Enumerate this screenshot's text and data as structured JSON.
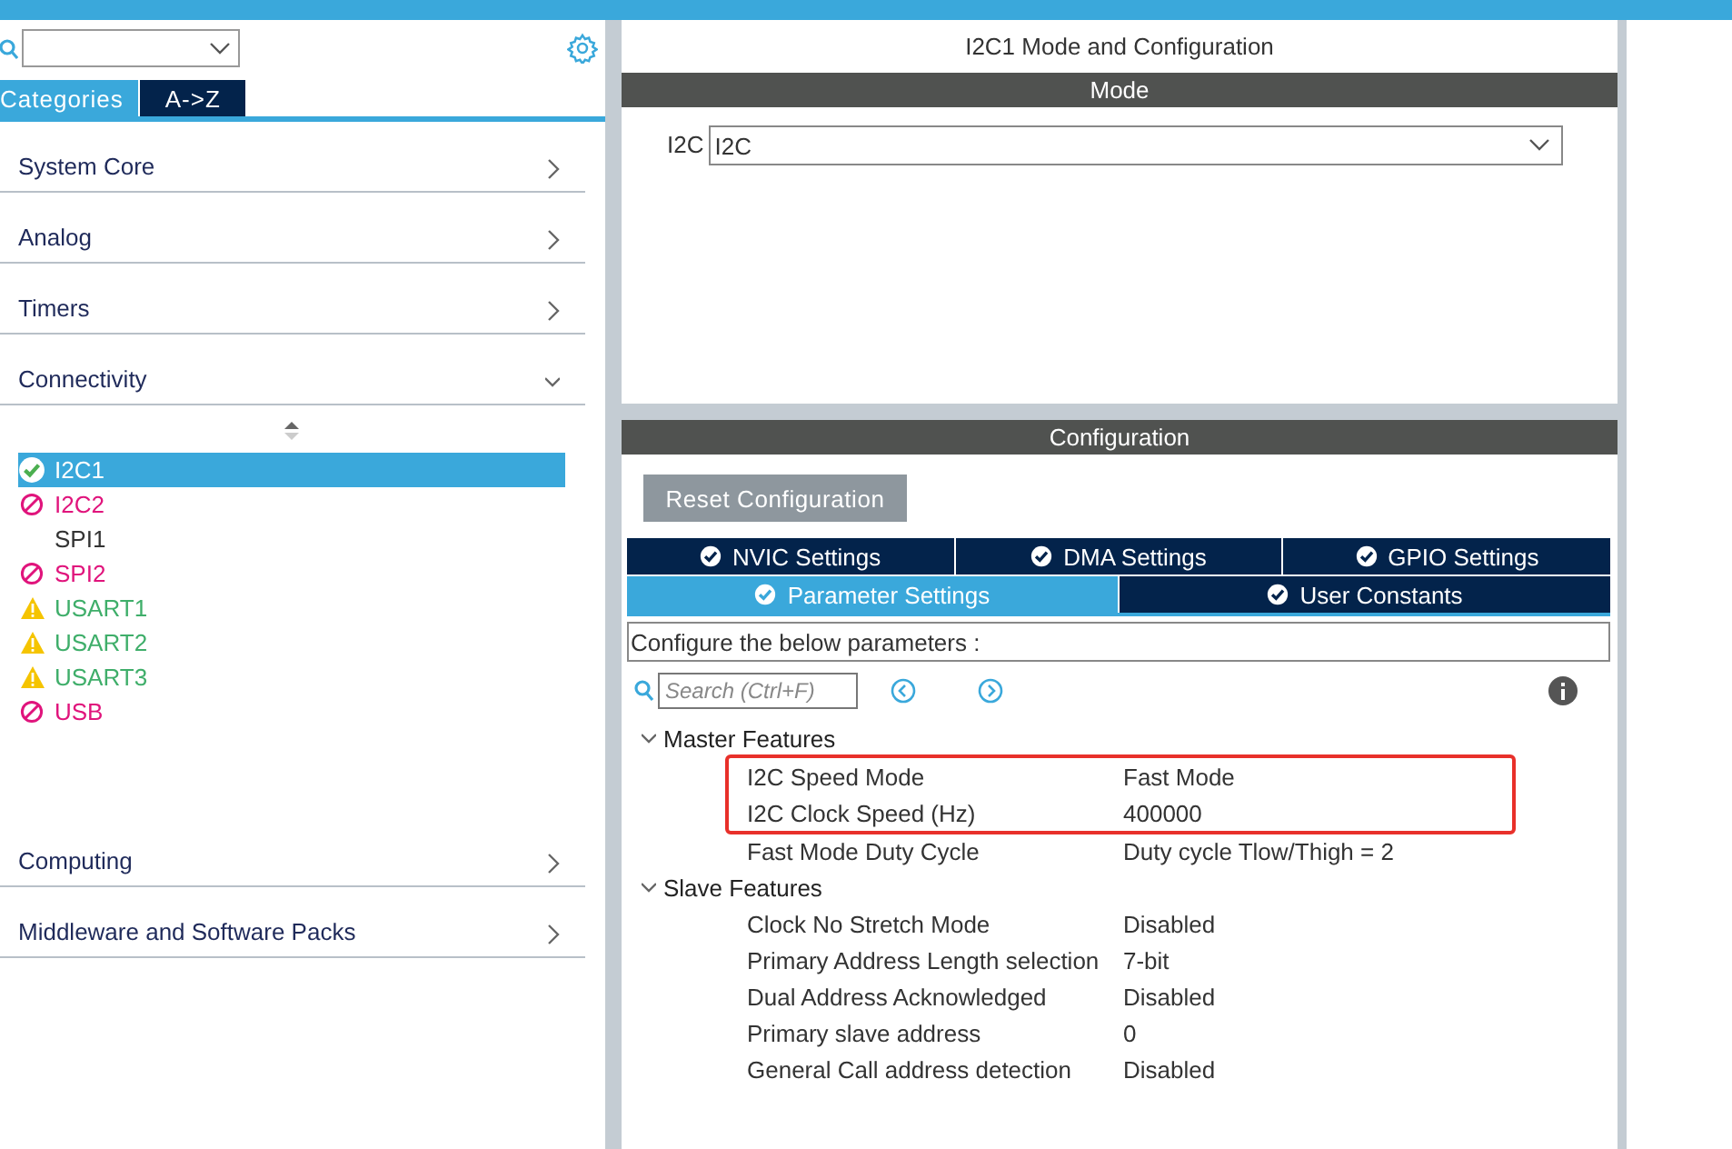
{
  "sidebar": {
    "view_tabs": [
      {
        "label": "Categories",
        "selected": true
      },
      {
        "label": "A->Z",
        "selected": false
      }
    ],
    "categories": [
      {
        "label": "System Core",
        "expanded": false
      },
      {
        "label": "Analog",
        "expanded": false
      },
      {
        "label": "Timers",
        "expanded": false
      },
      {
        "label": "Connectivity",
        "expanded": true,
        "children": [
          {
            "label": "I2C1",
            "kind": "ok",
            "selected": true
          },
          {
            "label": "I2C2",
            "kind": "blocked",
            "selected": false
          },
          {
            "label": "SPI1",
            "kind": "none",
            "selected": false
          },
          {
            "label": "SPI2",
            "kind": "blocked",
            "selected": false
          },
          {
            "label": "USART1",
            "kind": "warning",
            "selected": false
          },
          {
            "label": "USART2",
            "kind": "warning",
            "selected": false
          },
          {
            "label": "USART3",
            "kind": "warning",
            "selected": false
          },
          {
            "label": "USB",
            "kind": "blocked",
            "selected": false
          }
        ]
      },
      {
        "label": "Computing",
        "expanded": false
      },
      {
        "label": "Middleware and Software Packs",
        "expanded": false
      }
    ]
  },
  "main": {
    "title": "I2C1 Mode and Configuration",
    "mode": {
      "header": "Mode",
      "field_label": "I2C",
      "field_value": "I2C"
    },
    "configuration": {
      "header": "Configuration",
      "reset_button": "Reset Configuration",
      "tab_rows": [
        [
          {
            "label": "NVIC Settings",
            "selected": false
          },
          {
            "label": "DMA Settings",
            "selected": false
          },
          {
            "label": "GPIO Settings",
            "selected": false
          }
        ],
        [
          {
            "label": "Parameter Settings",
            "selected": true
          },
          {
            "label": "User Constants",
            "selected": false
          }
        ]
      ],
      "hint": "Configure the below parameters :",
      "search_placeholder": "Search (Ctrl+F)",
      "groups": [
        {
          "name": "Master Features",
          "expanded": true,
          "params": [
            {
              "name": "I2C Speed Mode",
              "value": "Fast Mode",
              "highlighted": true
            },
            {
              "name": "I2C Clock Speed (Hz)",
              "value": "400000",
              "highlighted": true
            },
            {
              "name": "Fast Mode Duty Cycle",
              "value": "Duty cycle Tlow/Thigh = 2",
              "highlighted": false
            }
          ]
        },
        {
          "name": "Slave Features",
          "expanded": true,
          "params": [
            {
              "name": "Clock No Stretch Mode",
              "value": "Disabled",
              "highlighted": false
            },
            {
              "name": "Primary Address Length selection",
              "value": "7-bit",
              "highlighted": false
            },
            {
              "name": "Dual Address Acknowledged",
              "value": "Disabled",
              "highlighted": false
            },
            {
              "name": "Primary slave address",
              "value": "0",
              "highlighted": false
            },
            {
              "name": "General Call address detection",
              "value": "Disabled",
              "highlighted": false
            }
          ]
        }
      ]
    }
  }
}
